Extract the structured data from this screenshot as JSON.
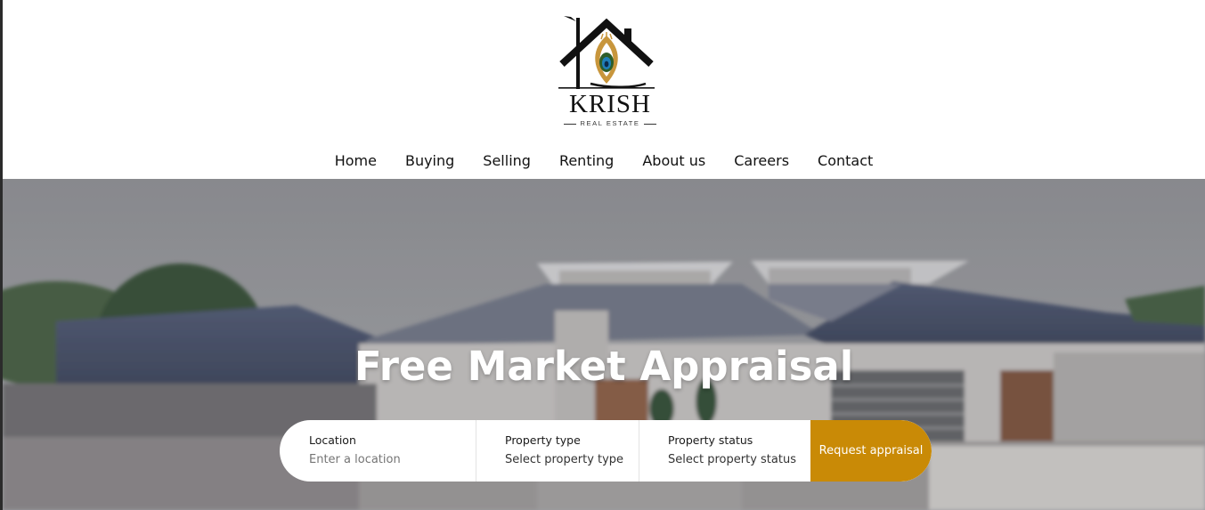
{
  "brand": {
    "name": "KRISH",
    "subtitle": "REAL ESTATE"
  },
  "nav": {
    "items": [
      "Home",
      "Buying",
      "Selling",
      "Renting",
      "About us",
      "Careers",
      "Contact"
    ]
  },
  "hero": {
    "title": "Free Market Appraisal"
  },
  "search": {
    "location_label": "Location",
    "location_placeholder": "Enter a location",
    "type_label": "Property type",
    "type_value": "Select property type",
    "status_label": "Property status",
    "status_value": "Select property status",
    "submit_label": "Request appraisal"
  },
  "colors": {
    "accent": "#c98a06",
    "logo_gold": "#c8963c",
    "logo_blue": "#1f7fb8"
  }
}
